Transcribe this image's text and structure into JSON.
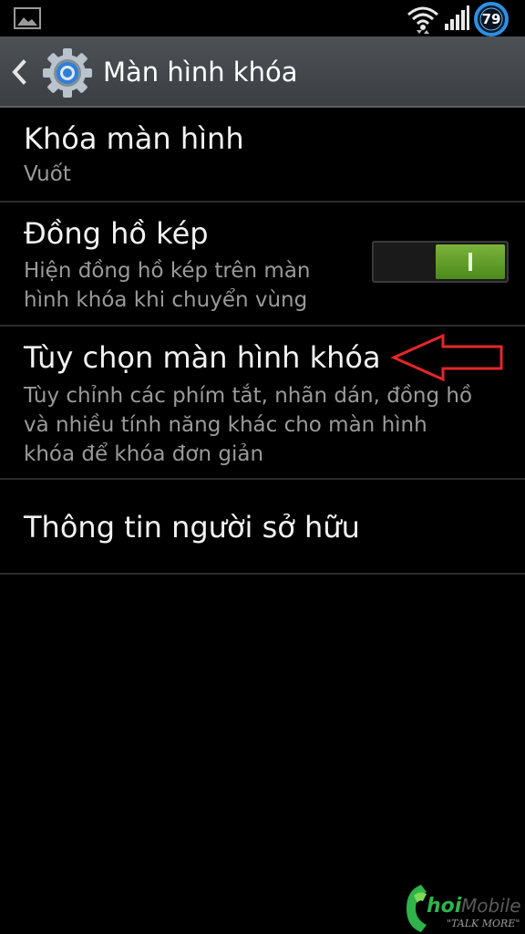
{
  "status_bar": {
    "battery_level": "79",
    "icons": [
      "gallery-icon",
      "wifi-icon",
      "signal-icon",
      "battery-icon"
    ]
  },
  "action_bar": {
    "title": "Màn hình khóa",
    "back_icon": "back-icon",
    "app_icon": "gear-icon"
  },
  "settings": {
    "items": [
      {
        "title": "Khóa màn hình",
        "subtitle": "Vuốt"
      },
      {
        "title": "Đồng hồ kép",
        "subtitle_line1": "Hiện đồng hồ kép trên màn",
        "subtitle_line2": "hình khóa khi chuyển vùng",
        "toggle_state": "on"
      },
      {
        "title": "Tùy chọn màn hình khóa",
        "subtitle_line1": "Tùy chỉnh các phím tắt, nhãn dán, đồng hồ",
        "subtitle_line2": "và nhiều tính năng khác cho màn hình",
        "subtitle_line3": "khóa để khóa đơn giản"
      },
      {
        "title": "Thông tin người sở hữu"
      }
    ]
  },
  "colors": {
    "background": "#000000",
    "action_bar": "#43474c",
    "toggle_on": "#62a02a",
    "annotation": "#e8252a"
  },
  "watermark": {
    "brand": "ChoiMobile",
    "tagline": "\"TALK MORE\""
  }
}
